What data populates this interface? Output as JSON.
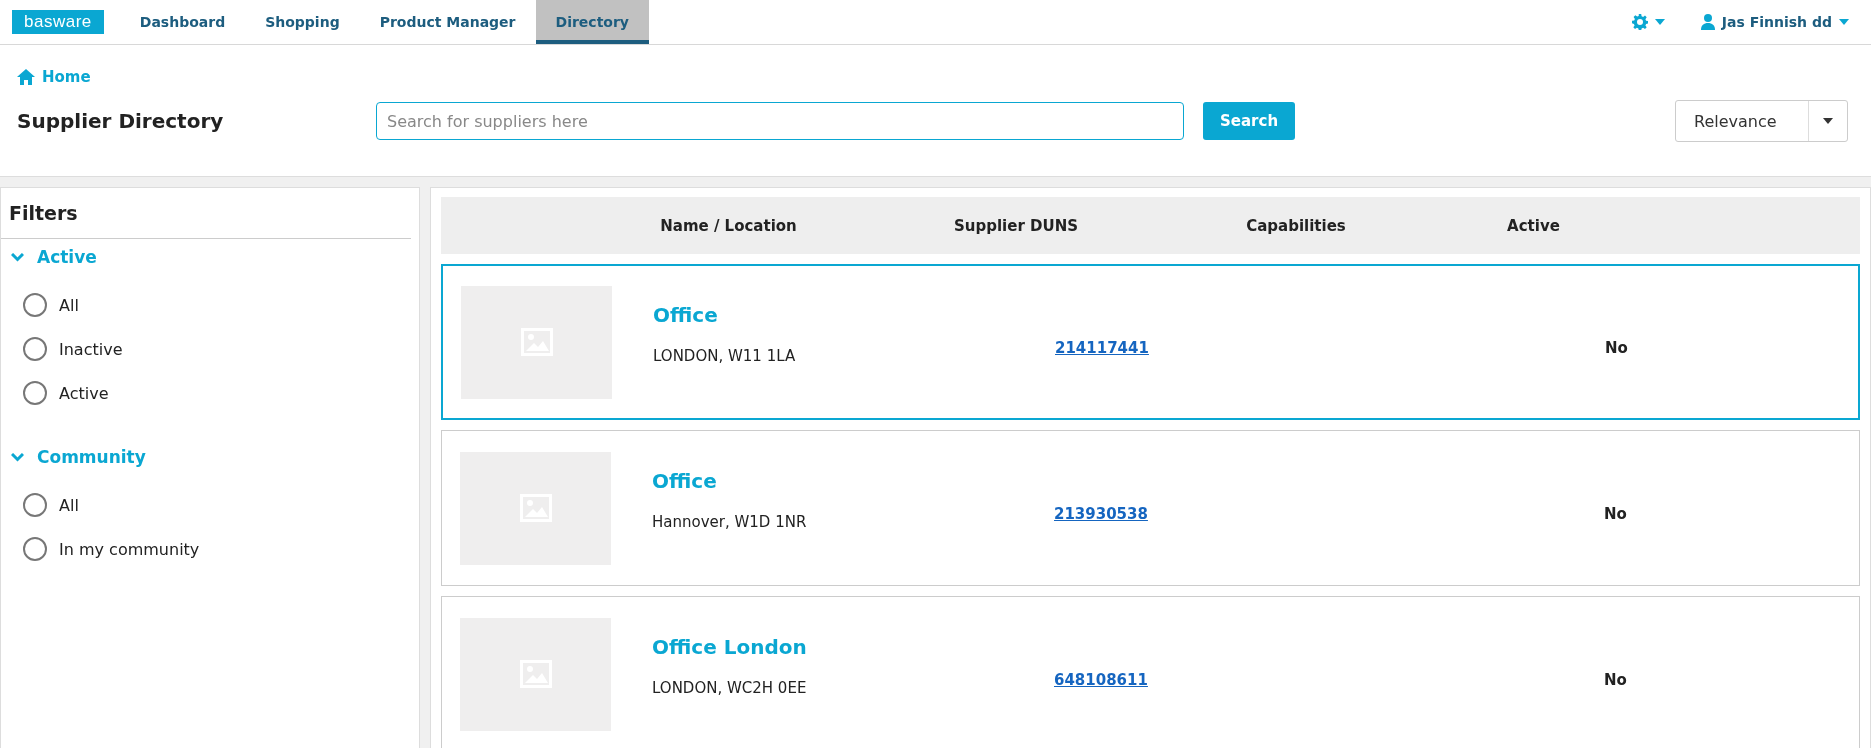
{
  "nav": {
    "logo": "basware",
    "tabs": [
      {
        "label": "Dashboard",
        "selected": false
      },
      {
        "label": "Shopping",
        "selected": false
      },
      {
        "label": "Product Manager",
        "selected": false
      },
      {
        "label": "Directory",
        "selected": true
      }
    ],
    "user": "Jas Finnish dd"
  },
  "breadcrumb": "Home",
  "page_title": "Supplier Directory",
  "search": {
    "placeholder": "Search for suppliers here",
    "button": "Search"
  },
  "sort": {
    "value": "Relevance"
  },
  "filters": {
    "title": "Filters",
    "groups": [
      {
        "label": "Active",
        "expanded": true,
        "options": [
          {
            "label": "All",
            "selected": false
          },
          {
            "label": "Inactive",
            "selected": false
          },
          {
            "label": "Active",
            "selected": false
          }
        ]
      },
      {
        "label": "Community",
        "expanded": true,
        "options": [
          {
            "label": "All",
            "selected": false
          },
          {
            "label": "In my community",
            "selected": false
          }
        ]
      }
    ]
  },
  "table": {
    "columns": [
      "Name / Location",
      "Supplier DUNS",
      "Capabilities",
      "Active"
    ],
    "rows": [
      {
        "name": "Office",
        "location": "LONDON, W11 1LA",
        "duns": "214117441",
        "active": "No",
        "selected": true
      },
      {
        "name": "Office",
        "location": "Hannover, W1D 1NR",
        "duns": "213930538",
        "active": "No",
        "selected": false
      },
      {
        "name": "Office London",
        "location": "LONDON, WC2H 0EE",
        "duns": "648108611",
        "active": "No",
        "selected": false
      }
    ]
  }
}
